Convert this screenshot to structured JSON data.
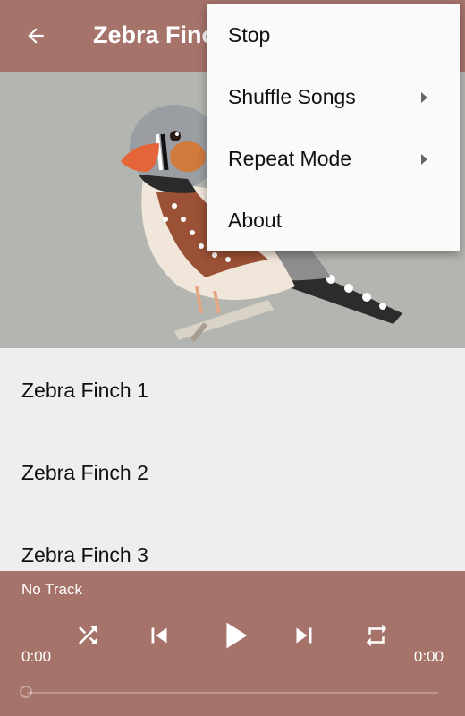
{
  "appbar": {
    "title": "Zebra Finch",
    "back_icon": "arrow-left-icon"
  },
  "header_image": {
    "alt": "Zebra Finch"
  },
  "tracks": [
    {
      "label": "Zebra Finch 1"
    },
    {
      "label": "Zebra Finch 2"
    },
    {
      "label": "Zebra Finch 3"
    }
  ],
  "player": {
    "now_playing": "No Track",
    "time_elapsed": "0:00",
    "time_total": "0:00",
    "progress": 0,
    "icons": [
      "shuffle-icon",
      "skip-previous-icon",
      "play-icon",
      "skip-next-icon",
      "repeat-icon"
    ]
  },
  "overflow_menu": {
    "items": [
      {
        "label": "Stop",
        "has_submenu": false
      },
      {
        "label": "Shuffle Songs",
        "has_submenu": true
      },
      {
        "label": "Repeat Mode",
        "has_submenu": true
      },
      {
        "label": "About",
        "has_submenu": false
      }
    ]
  },
  "colors": {
    "accent": "#a6736b",
    "background": "#eeeeee",
    "menu": "#fafafa"
  }
}
